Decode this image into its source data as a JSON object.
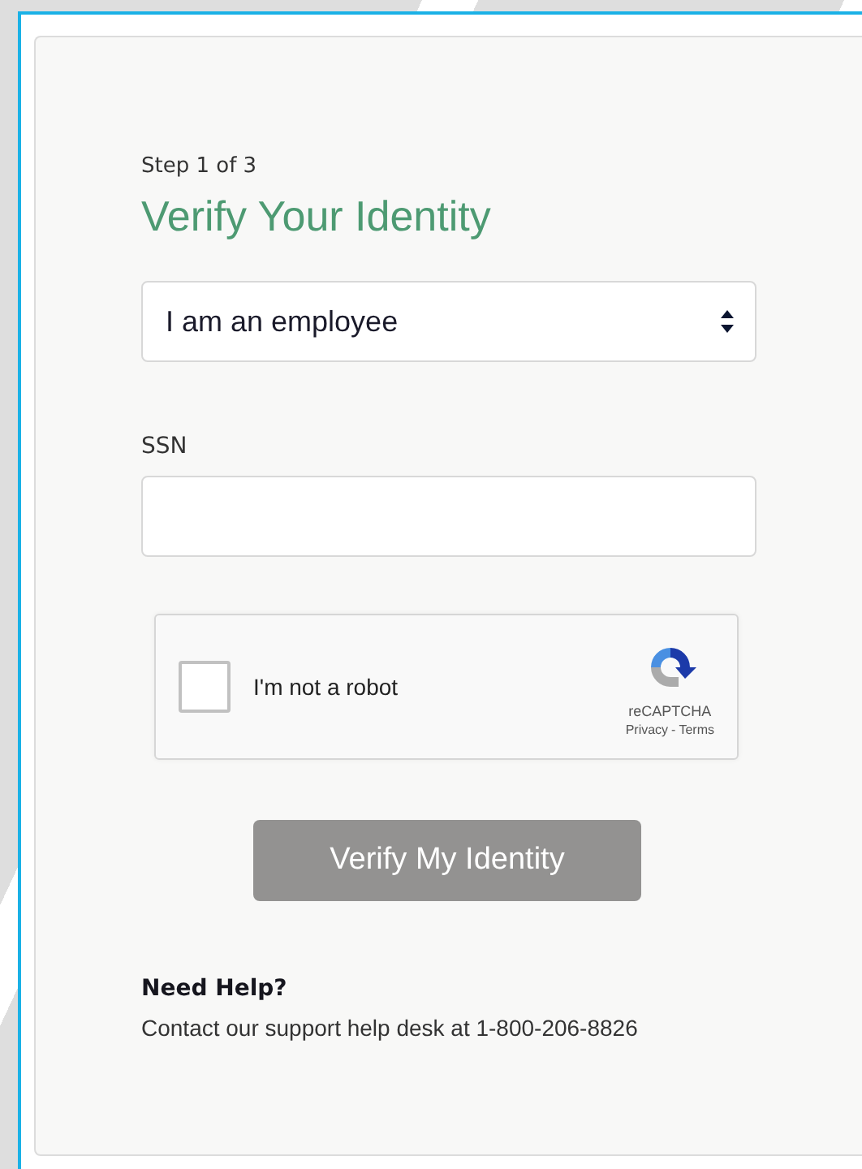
{
  "form": {
    "step": "Step 1 of 3",
    "title": "Verify Your Identity",
    "role_select": {
      "value": "I am an employee"
    },
    "ssn": {
      "label": "SSN"
    },
    "captcha": {
      "label": "I'm not a robot",
      "checked": false,
      "brand": "reCAPTCHA",
      "privacy": "Privacy",
      "separator": "-",
      "terms": "Terms"
    },
    "submit": {
      "label": "Verify My Identity",
      "disabled": true
    }
  },
  "help": {
    "title": "Need Help?",
    "text": "Contact our support help desk at 1-800-206-8826"
  }
}
